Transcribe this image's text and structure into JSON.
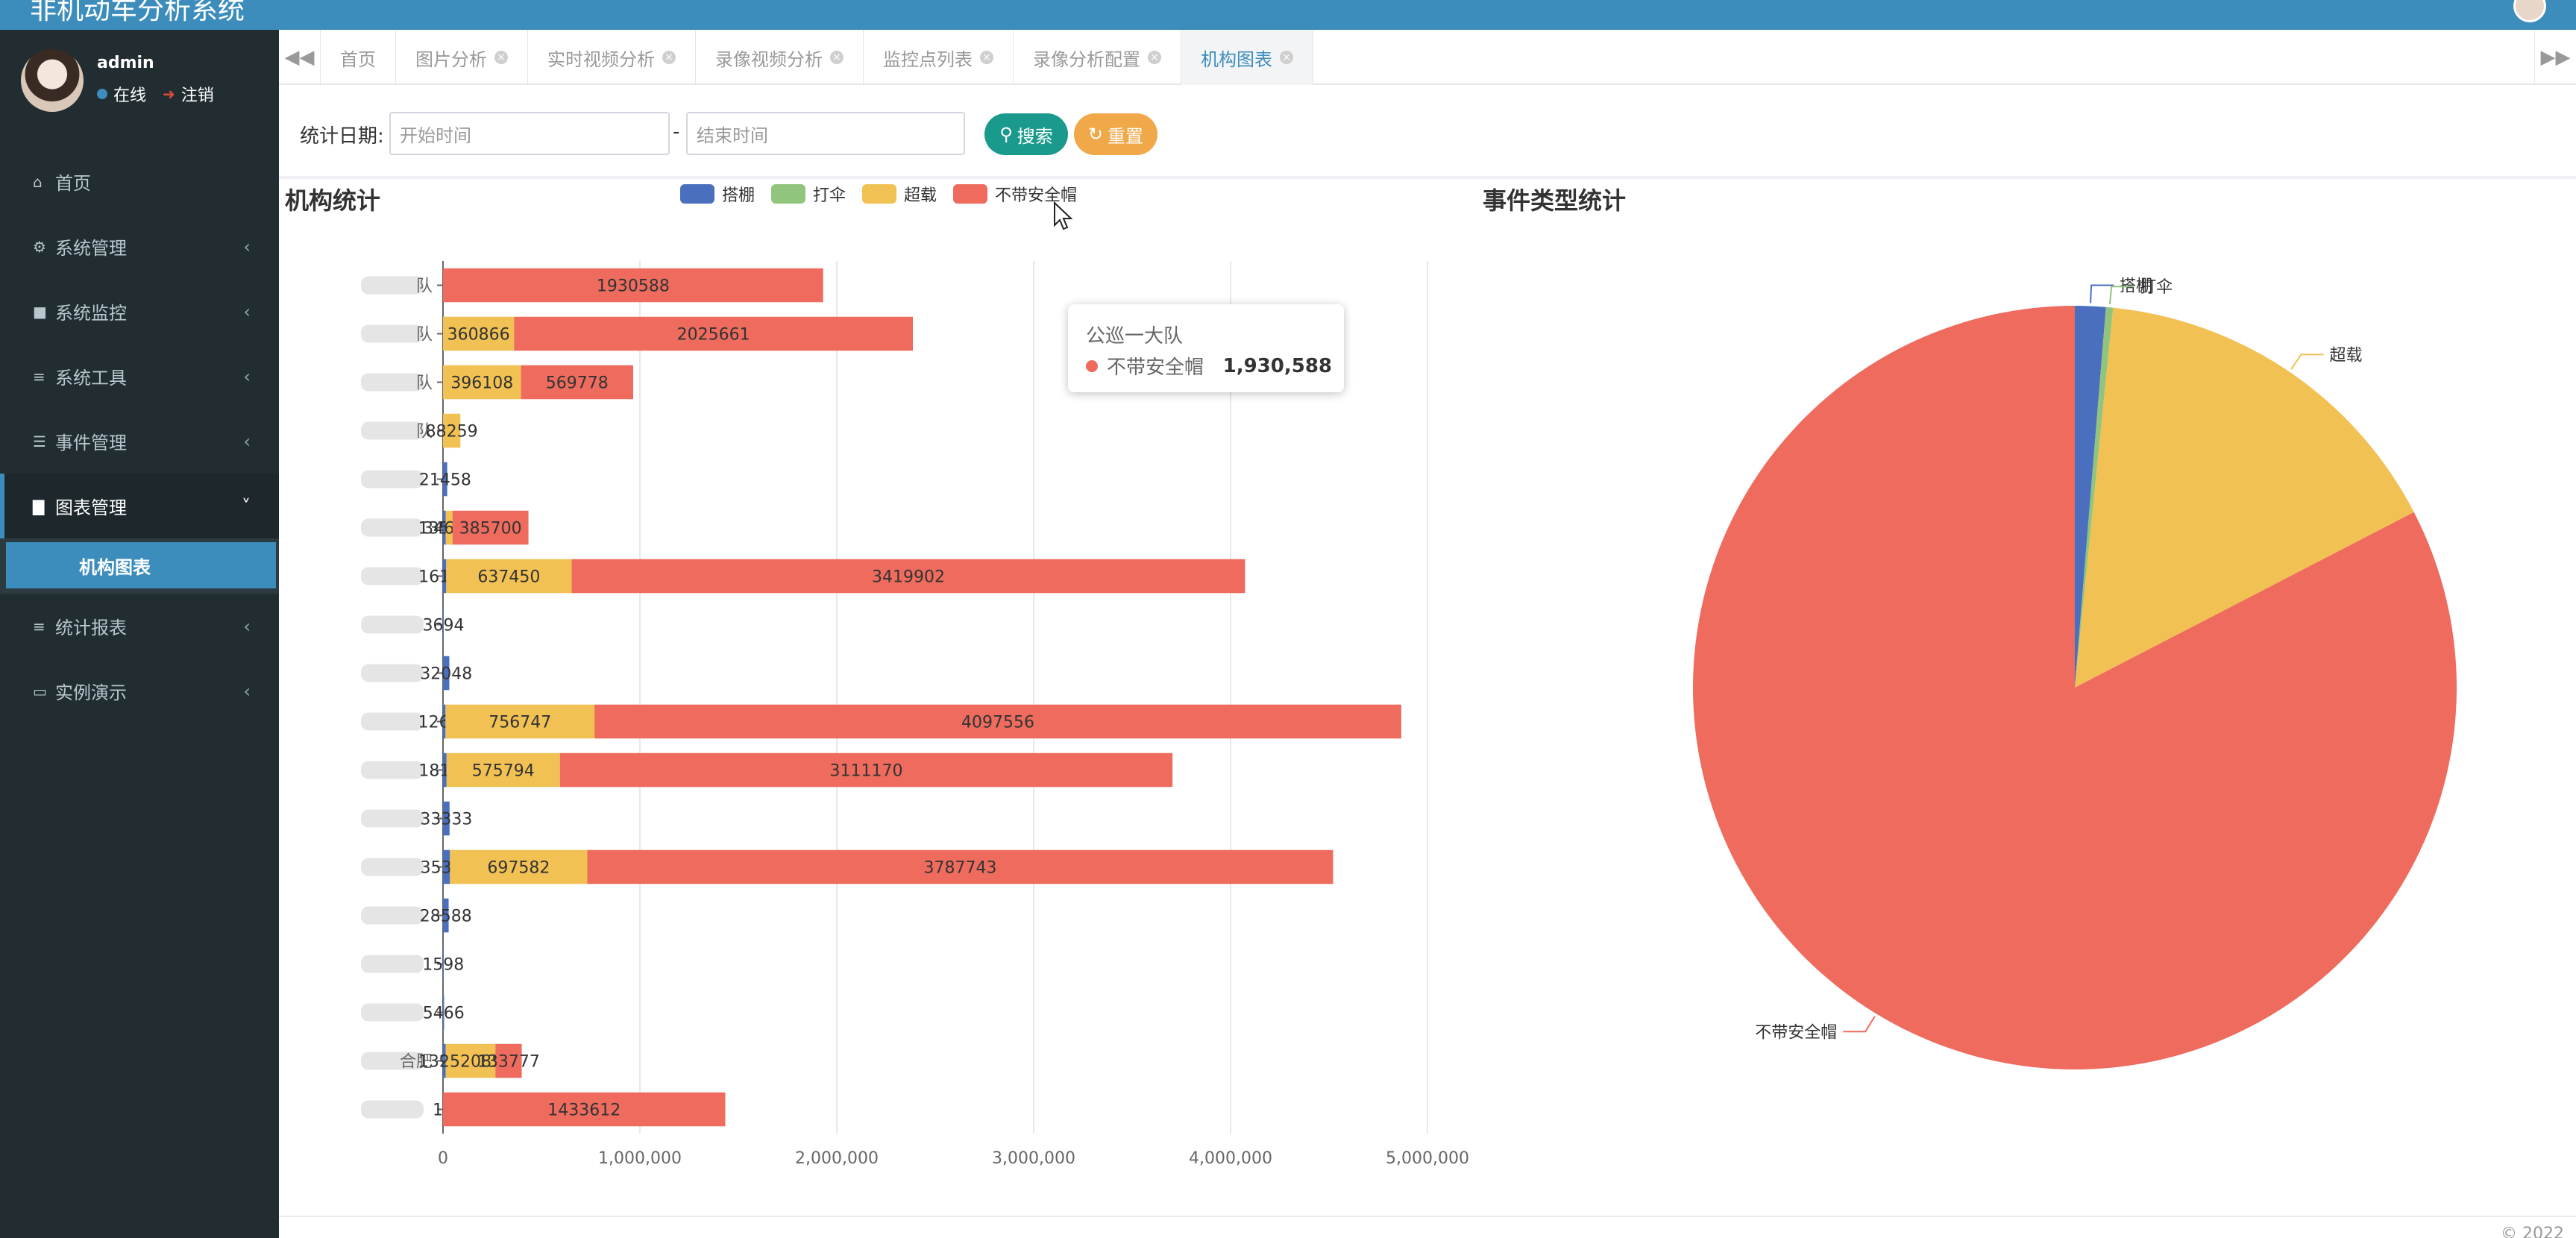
{
  "app": {
    "title": "非机动车分析系统",
    "top_right_items": [
      "",
      ""
    ]
  },
  "user": {
    "name": "admin",
    "status": "在线",
    "logout": "注销"
  },
  "sidebar": {
    "items": [
      {
        "label": "首页",
        "icon": "home-icon",
        "chevron": false
      },
      {
        "label": "系统管理",
        "icon": "gear-icon",
        "chevron": true
      },
      {
        "label": "系统监控",
        "icon": "video-icon",
        "chevron": true
      },
      {
        "label": "系统工具",
        "icon": "bars-icon",
        "chevron": true
      },
      {
        "label": "事件管理",
        "icon": "list-icon",
        "chevron": true
      },
      {
        "label": "图表管理",
        "icon": "bar-chart-icon",
        "chevron": true,
        "open": true
      },
      {
        "label": "统计报表",
        "icon": "bars-icon",
        "chevron": true
      },
      {
        "label": "实例演示",
        "icon": "desktop-icon",
        "chevron": true
      }
    ],
    "active_sub": "机构图表"
  },
  "tabs": [
    {
      "label": "首页",
      "closable": false
    },
    {
      "label": "图片分析",
      "closable": true
    },
    {
      "label": "实时视频分析",
      "closable": true
    },
    {
      "label": "录像视频分析",
      "closable": true
    },
    {
      "label": "监控点列表",
      "closable": true
    },
    {
      "label": "录像分析配置",
      "closable": true
    },
    {
      "label": "机构图表",
      "closable": true,
      "active": true
    }
  ],
  "search": {
    "label": "统计日期:",
    "start_placeholder": "开始时间",
    "end_placeholder": "结束时间",
    "dash": "-",
    "search_button": "搜索",
    "reset_button": "重置"
  },
  "chart_data": [
    {
      "type": "bar",
      "orientation": "horizontal",
      "stacked": true,
      "title": "机构统计",
      "legend_position": "top",
      "categories": [
        "队",
        "队",
        "队",
        "队",
        "",
        "",
        "",
        "",
        "",
        "",
        "",
        "",
        "",
        "",
        "",
        "",
        "合肥",
        ""
      ],
      "series": [
        {
          "name": "搭棚",
          "color": "#4a6fbf",
          "values": [
            0,
            0,
            0,
            0,
            21458,
            13584,
            16178,
            3694,
            32048,
            12690,
            18108,
            33333,
            35381,
            28588,
            1598,
            5466,
            13956,
            17
          ]
        },
        {
          "name": "打伞",
          "color": "#91c47c",
          "values": [
            0,
            0,
            0,
            0,
            0,
            0,
            0,
            0,
            0,
            0,
            0,
            0,
            0,
            0,
            0,
            0,
            0,
            0
          ]
        },
        {
          "name": "超载",
          "color": "#f2c153",
          "values": [
            0,
            360866,
            396108,
            88259,
            0,
            34640,
            637450,
            0,
            0,
            756747,
            575794,
            0,
            697582,
            0,
            0,
            0,
            252085,
            0
          ]
        },
        {
          "name": "不带安全帽",
          "color": "#ee6b5e",
          "values": [
            1930588,
            2025661,
            569778,
            0,
            0,
            385700,
            3419902,
            0,
            0,
            4097556,
            3111170,
            0,
            3787743,
            0,
            0,
            0,
            133777,
            1433612
          ]
        }
      ],
      "xlim": [
        0,
        5000000
      ],
      "x_ticks": [
        "0",
        "1,000,000",
        "2,000,000",
        "3,000,000",
        "4,000,000",
        "5,000,000"
      ],
      "tooltip": {
        "title": "公巡一大队",
        "series": "不带安全帽",
        "value": "1,930,588"
      }
    },
    {
      "type": "pie",
      "title": "事件类型统计",
      "slices": [
        {
          "name": "搭棚",
          "value": 1.3,
          "color": "#4a6fbf"
        },
        {
          "name": "打伞",
          "value": 0.3,
          "color": "#91c47c"
        },
        {
          "name": "超载",
          "value": 15.8,
          "color": "#f2c153"
        },
        {
          "name": "不带安全帽",
          "value": 82.6,
          "color": "#ee6b5e"
        }
      ]
    }
  ],
  "footer": {
    "text": "© 2022"
  }
}
